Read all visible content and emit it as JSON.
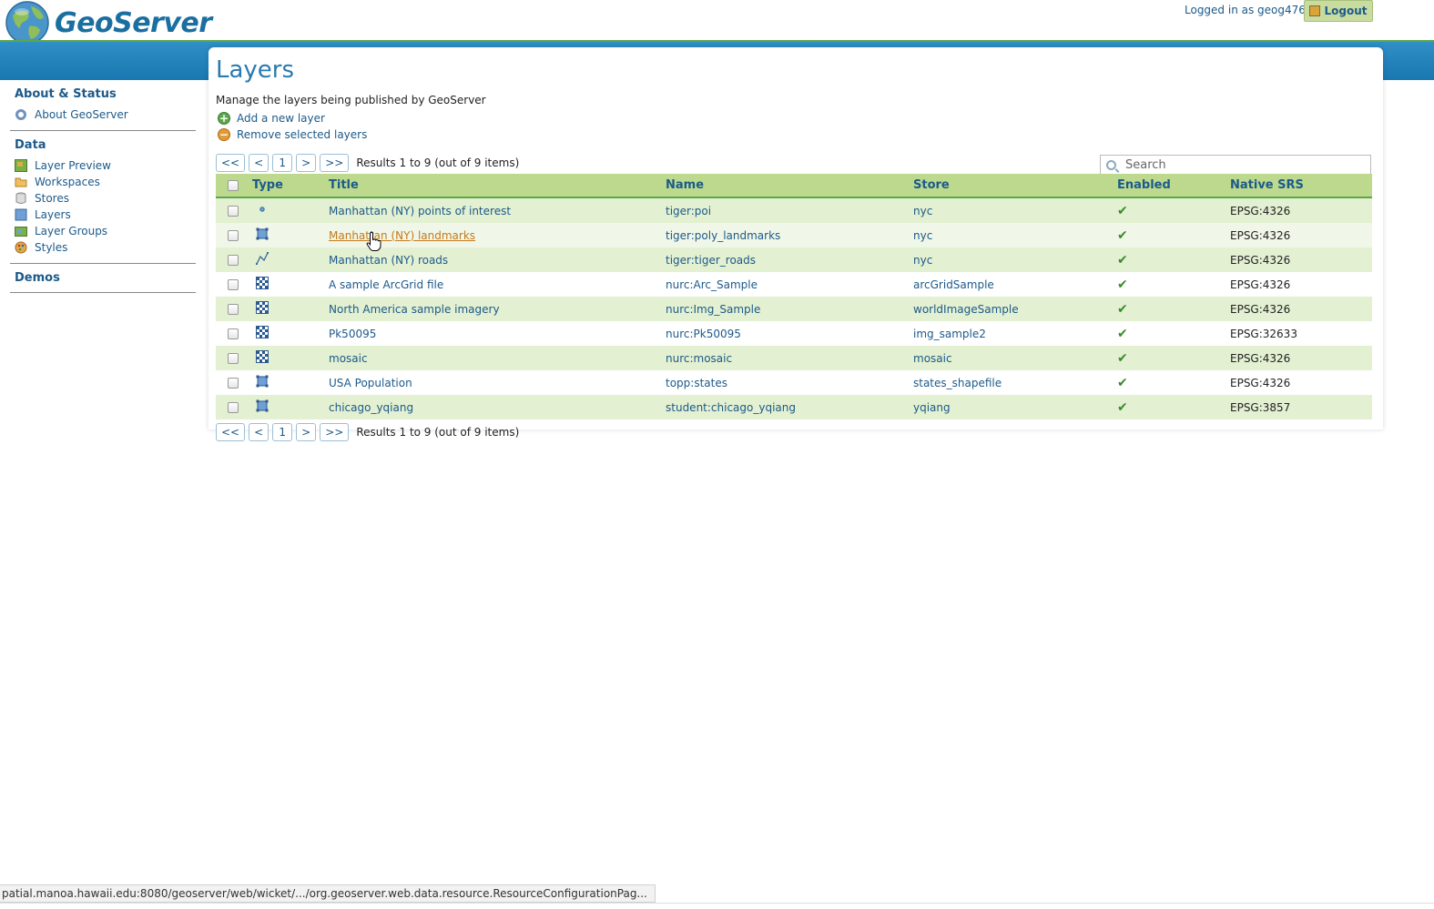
{
  "header": {
    "app_name": "GeoServer",
    "login_text": "Logged in as geog476.",
    "logout_label": "Logout"
  },
  "sidebar": {
    "sections": [
      {
        "heading": "About & Status",
        "items": [
          {
            "label": "About GeoServer",
            "icon": "info-icon"
          }
        ]
      },
      {
        "heading": "Data",
        "items": [
          {
            "label": "Layer Preview",
            "icon": "map-preview-icon"
          },
          {
            "label": "Workspaces",
            "icon": "folder-icon"
          },
          {
            "label": "Stores",
            "icon": "database-icon"
          },
          {
            "label": "Layers",
            "icon": "layer-icon"
          },
          {
            "label": "Layer Groups",
            "icon": "layer-group-icon"
          },
          {
            "label": "Styles",
            "icon": "palette-icon"
          }
        ]
      },
      {
        "heading": "Demos",
        "items": []
      }
    ]
  },
  "page": {
    "title": "Layers",
    "description": "Manage the layers being published by GeoServer",
    "add_label": "Add a new layer",
    "remove_label": "Remove selected layers",
    "search_placeholder": "Search"
  },
  "pager": {
    "first": "<<",
    "prev": "<",
    "page": "1",
    "next": ">",
    "last": ">>",
    "result_text": "Results 1 to 9 (out of 9 items)"
  },
  "table": {
    "columns": {
      "type": "Type",
      "title": "Title",
      "name": "Name",
      "store": "Store",
      "enabled": "Enabled",
      "srs": "Native SRS"
    },
    "rows": [
      {
        "type": "point",
        "title": "Manhattan (NY) points of interest",
        "name": "tiger:poi",
        "store": "nyc",
        "enabled": "✔",
        "srs": "EPSG:4326"
      },
      {
        "type": "polygon",
        "title": "Manhattan (NY) landmarks",
        "name": "tiger:poly_landmarks",
        "store": "nyc",
        "enabled": "✔",
        "srs": "EPSG:4326"
      },
      {
        "type": "line",
        "title": "Manhattan (NY) roads",
        "name": "tiger:tiger_roads",
        "store": "nyc",
        "enabled": "✔",
        "srs": "EPSG:4326"
      },
      {
        "type": "raster",
        "title": "A sample ArcGrid file",
        "name": "nurc:Arc_Sample",
        "store": "arcGridSample",
        "enabled": "✔",
        "srs": "EPSG:4326"
      },
      {
        "type": "raster",
        "title": "North America sample imagery",
        "name": "nurc:Img_Sample",
        "store": "worldImageSample",
        "enabled": "✔",
        "srs": "EPSG:4326"
      },
      {
        "type": "raster",
        "title": "Pk50095",
        "name": "nurc:Pk50095",
        "store": "img_sample2",
        "enabled": "✔",
        "srs": "EPSG:32633"
      },
      {
        "type": "raster",
        "title": "mosaic",
        "name": "nurc:mosaic",
        "store": "mosaic",
        "enabled": "✔",
        "srs": "EPSG:4326"
      },
      {
        "type": "polygon",
        "title": "USA Population",
        "name": "topp:states",
        "store": "states_shapefile",
        "enabled": "✔",
        "srs": "EPSG:4326"
      },
      {
        "type": "polygon",
        "title": "chicago_yqiang",
        "name": "student:chicago_yqiang",
        "store": "yqiang",
        "enabled": "✔",
        "srs": "EPSG:3857"
      }
    ]
  },
  "status_bar": {
    "url": "patial.manoa.hawaii.edu:8080/geoserver/web/wicket/.../org.geoserver.web.data.resource.ResourceConfigurationPag..."
  },
  "colors": {
    "brand_blue": "#1a6fa0",
    "header_bar": "#1a77b1",
    "table_header": "#bcd98d",
    "row_odd": "#e3f0d1",
    "link": "#1c5a8a",
    "link_hover": "#c47a1a",
    "check_green": "#3b8a2a"
  }
}
